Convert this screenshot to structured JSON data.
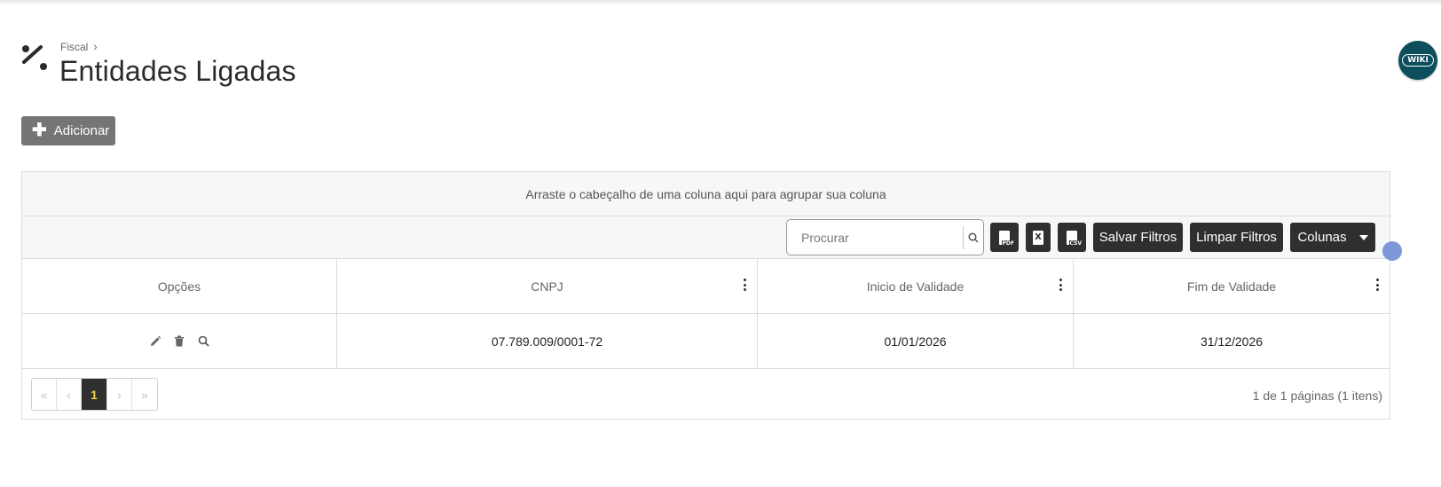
{
  "breadcrumb": {
    "parent": "Fiscal"
  },
  "page": {
    "title": "Entidades Ligadas"
  },
  "wiki": {
    "label": "WIKI"
  },
  "actions": {
    "add_label": "Adicionar"
  },
  "grid": {
    "group_hint": "Arraste o cabeçalho de uma coluna aqui para agrupar sua coluna",
    "search": {
      "placeholder": "Procurar",
      "value": ""
    },
    "toolbar": {
      "pdf_tag": "PDF",
      "excel_tag": "X",
      "csv_tag": "CSV",
      "save_filters": "Salvar Filtros",
      "clear_filters": "Limpar Filtros",
      "columns": "Colunas"
    },
    "columns": [
      "Opções",
      "CNPJ",
      "Inicio de Validade",
      "Fim de Validade"
    ],
    "rows": [
      {
        "cnpj": "07.789.009/0001-72",
        "inicio": "01/01/2026",
        "fim": "31/12/2026"
      }
    ],
    "pager": {
      "first": "«",
      "prev": "‹",
      "current": "1",
      "next": "›",
      "last": "»",
      "info": "1 de 1 páginas (1 itens)"
    }
  }
}
